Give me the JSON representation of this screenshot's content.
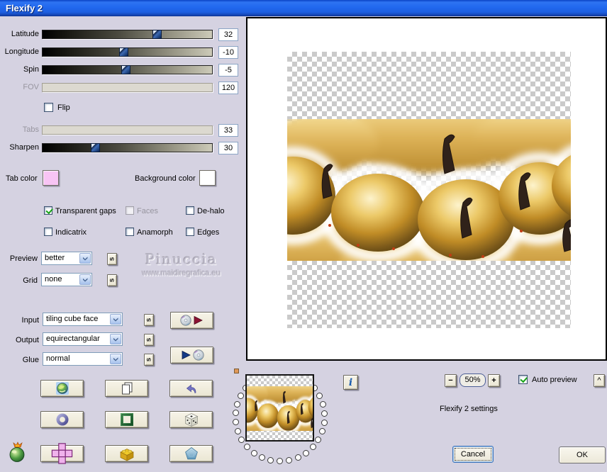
{
  "window": {
    "title": "Flexify 2"
  },
  "sliders": {
    "latitude": {
      "label": "Latitude",
      "value": "32"
    },
    "longitude": {
      "label": "Longitude",
      "value": "-10"
    },
    "spin": {
      "label": "Spin",
      "value": "-5"
    },
    "fov": {
      "label": "FOV",
      "value": "120"
    },
    "tabs": {
      "label": "Tabs",
      "value": "33"
    },
    "sharpen": {
      "label": "Sharpen",
      "value": "30"
    }
  },
  "flip": {
    "label": "Flip",
    "checked": false
  },
  "swatches": {
    "tab_color_label": "Tab color",
    "tab_color": "#f8c4f4",
    "background_color_label": "Background color",
    "background_color": "#ffffff"
  },
  "options": [
    {
      "label": "Transparent gaps",
      "checked": true,
      "disabled": false
    },
    {
      "label": "Faces",
      "checked": false,
      "disabled": true
    },
    {
      "label": "De-halo",
      "checked": false,
      "disabled": false
    },
    {
      "label": "Indicatrix",
      "checked": false,
      "disabled": false
    },
    {
      "label": "Anamorph",
      "checked": false,
      "disabled": false
    },
    {
      "label": "Edges",
      "checked": false,
      "disabled": false
    }
  ],
  "selects": {
    "preview": {
      "label": "Preview",
      "value": "better"
    },
    "grid": {
      "label": "Grid",
      "value": "none"
    },
    "input": {
      "label": "Input",
      "value": "tiling cube face"
    },
    "output": {
      "label": "Output",
      "value": "equirectangular"
    },
    "glue": {
      "label": "Glue",
      "value": "normal"
    }
  },
  "s_button_label": "s",
  "watermark": {
    "line1": "Pinuccia",
    "line2": "www.maidiregrafica.eu"
  },
  "zoom_controls": {
    "minus": "−",
    "level": "50%",
    "plus": "+"
  },
  "auto_preview": {
    "label": "Auto preview",
    "checked": true
  },
  "status_text": "Flexify 2 settings",
  "info_button_label": "i",
  "collapse_button_label": "^",
  "action_buttons": {
    "cancel": "Cancel",
    "ok": "OK"
  },
  "icons": [
    "planet-icon",
    "copy-icon",
    "undo-icon",
    "torus-icon",
    "frame-icon",
    "dice-icon",
    "cube-net-icon",
    "brick-icon",
    "pentagon-icon",
    "cd-export-icon",
    "cd-import-icon",
    "info-icon",
    "flaming-pear-logo",
    "checkerboard-transparency"
  ],
  "accent_colors": {
    "titlebar_blue": "#1d5fe0",
    "dialog_bg": "#d5d2e1",
    "button_face": "#efecdd",
    "check_green": "#17a317",
    "textfield_border": "#7f9db9"
  }
}
